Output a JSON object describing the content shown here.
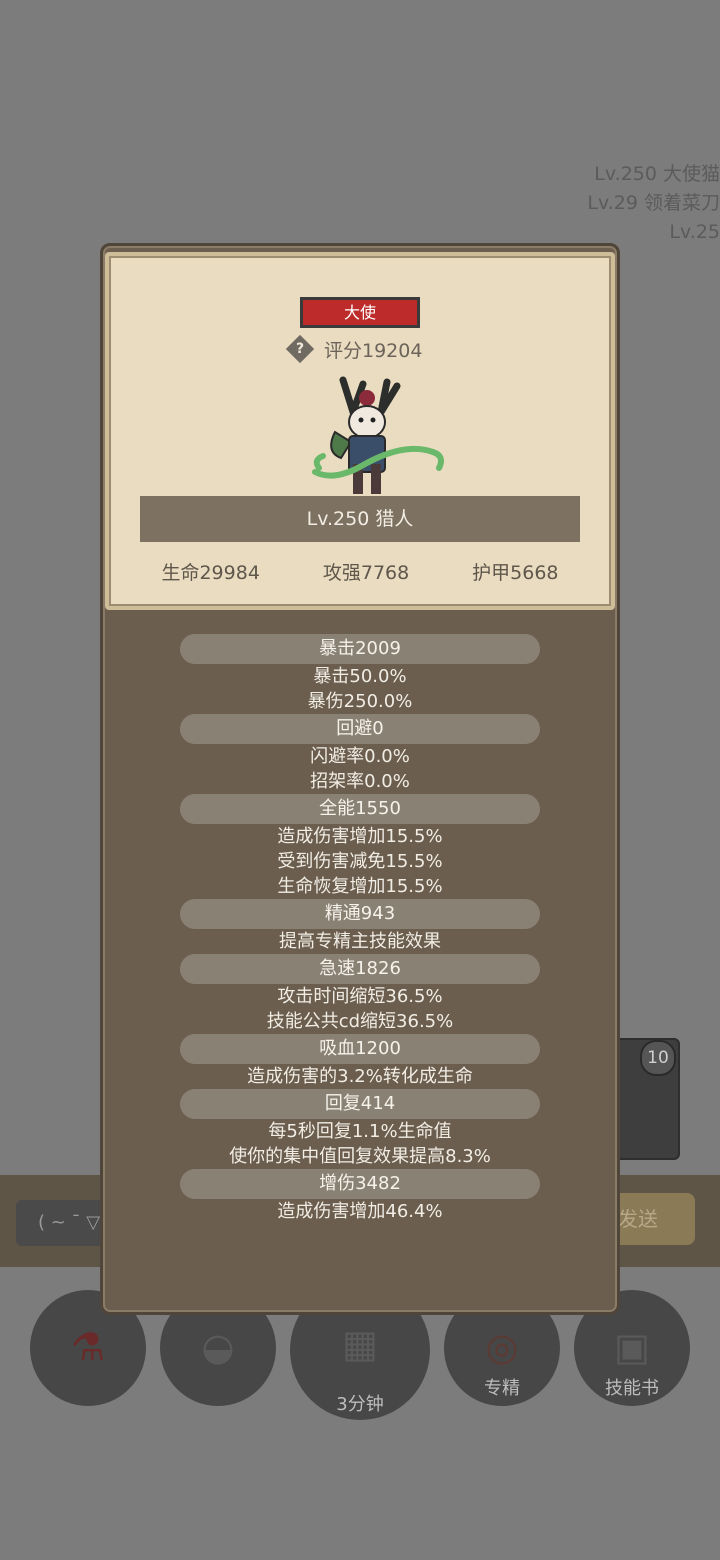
{
  "background": {
    "ranking_lines": [
      "Lv.250 大使猫",
      "Lv.29 领着菜刀",
      "Lv.25"
    ],
    "chat_placeholder": "( ~ ¯ ▽",
    "send_label": "发送",
    "skill_badge": "10",
    "bottom_buttons": [
      {
        "icon": "potion-icon",
        "label": ""
      },
      {
        "icon": "bread-icon",
        "label": ""
      },
      {
        "icon": "chest-icon",
        "label": "3分钟"
      },
      {
        "icon": "spec-icon",
        "label": "专精"
      },
      {
        "icon": "skillbook-icon",
        "label": "技能书"
      }
    ]
  },
  "card": {
    "rank": "大使",
    "score": "评分19204",
    "name": "Lv.250 猎人",
    "base_stats": [
      "生命29984",
      "攻强7768",
      "护甲5668"
    ]
  },
  "stats": [
    {
      "header": "暴击2009",
      "lines": [
        "暴击50.0%",
        "暴伤250.0%"
      ]
    },
    {
      "header": "回避0",
      "lines": [
        "闪避率0.0%",
        "招架率0.0%"
      ]
    },
    {
      "header": "全能1550",
      "lines": [
        "造成伤害增加15.5%",
        "受到伤害减免15.5%",
        "生命恢复增加15.5%"
      ]
    },
    {
      "header": "精通943",
      "lines": [
        "提高专精主技能效果"
      ]
    },
    {
      "header": "急速1826",
      "lines": [
        "攻击时间缩短36.5%",
        "技能公共cd缩短36.5%"
      ]
    },
    {
      "header": "吸血1200",
      "lines": [
        "造成伤害的3.2%转化成生命"
      ]
    },
    {
      "header": "回复414",
      "lines": [
        "每5秒回复1.1%生命值",
        "使你的集中值回复效果提高8.3%"
      ]
    },
    {
      "header": "增伤3482",
      "lines": [
        "造成伤害增加46.4%"
      ]
    }
  ],
  "colors": {
    "rank_badge": "#bd2b2b",
    "panel": "#6b5e4e",
    "card": "#e9dcc0"
  }
}
